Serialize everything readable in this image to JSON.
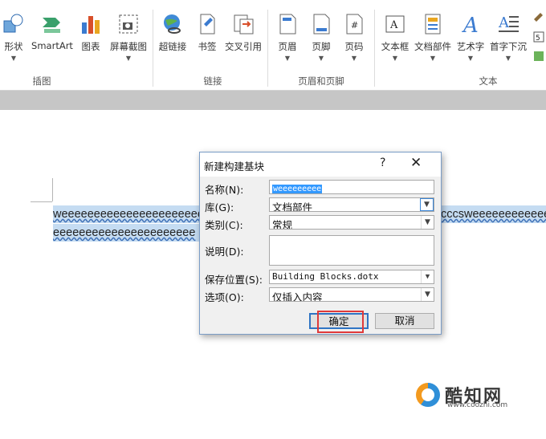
{
  "ribbon": {
    "buttons": [
      {
        "label": "形状",
        "has_dropdown": true,
        "icon": "shapes-icon"
      },
      {
        "label": "SmartArt",
        "has_dropdown": false,
        "icon": "smartart-icon"
      },
      {
        "label": "图表",
        "has_dropdown": false,
        "icon": "chart-icon"
      },
      {
        "label": "屏幕截图",
        "has_dropdown": true,
        "icon": "screenshot-icon"
      },
      {
        "label": "超链接",
        "has_dropdown": false,
        "icon": "hyperlink-icon"
      },
      {
        "label": "书签",
        "has_dropdown": false,
        "icon": "bookmark-icon"
      },
      {
        "label": "交叉引用",
        "has_dropdown": false,
        "icon": "cross-reference-icon"
      },
      {
        "label": "页眉",
        "has_dropdown": true,
        "icon": "header-icon"
      },
      {
        "label": "页脚",
        "has_dropdown": true,
        "icon": "footer-icon"
      },
      {
        "label": "页码",
        "has_dropdown": true,
        "icon": "page-number-icon"
      },
      {
        "label": "文本框",
        "has_dropdown": true,
        "icon": "textbox-icon"
      },
      {
        "label": "文档部件",
        "has_dropdown": true,
        "icon": "quick-parts-icon"
      },
      {
        "label": "艺术字",
        "has_dropdown": true,
        "icon": "wordart-icon"
      },
      {
        "label": "首字下沉",
        "has_dropdown": true,
        "icon": "drop-cap-icon"
      }
    ],
    "groups": {
      "illustrations": "插图",
      "links": "链接",
      "header_footer": "页眉和页脚",
      "text": "文本"
    }
  },
  "document": {
    "line1_left": "weeeeeeeeeeeeeeeeeeeeeeee",
    "line1_right": "cccsweeeeeeeeeeee",
    "line2_left": "eeeeeeeeeeeeeeeeeeeeee"
  },
  "dialog": {
    "title": "新建构建基块",
    "help": "?",
    "close": "✕",
    "name_label": "名称(N):",
    "name_value": "weeeeeeeee",
    "gallery_label": "库(G):",
    "gallery_value": "文档部件",
    "category_label": "类别(C):",
    "category_value": "常规",
    "description_label": "说明(D):",
    "save_label": "保存位置(S):",
    "save_value": "Building Blocks.dotx",
    "options_label": "选项(O):",
    "options_value": "仅插入内容",
    "ok_label": "确定",
    "cancel_label": "取消"
  },
  "watermark": {
    "brand": "酷知网",
    "url": "www.coozhi.com"
  },
  "colors": {
    "selection": "#c5dcf2",
    "highlight_box": "#e03a3a",
    "accent": "#2f74c4"
  }
}
